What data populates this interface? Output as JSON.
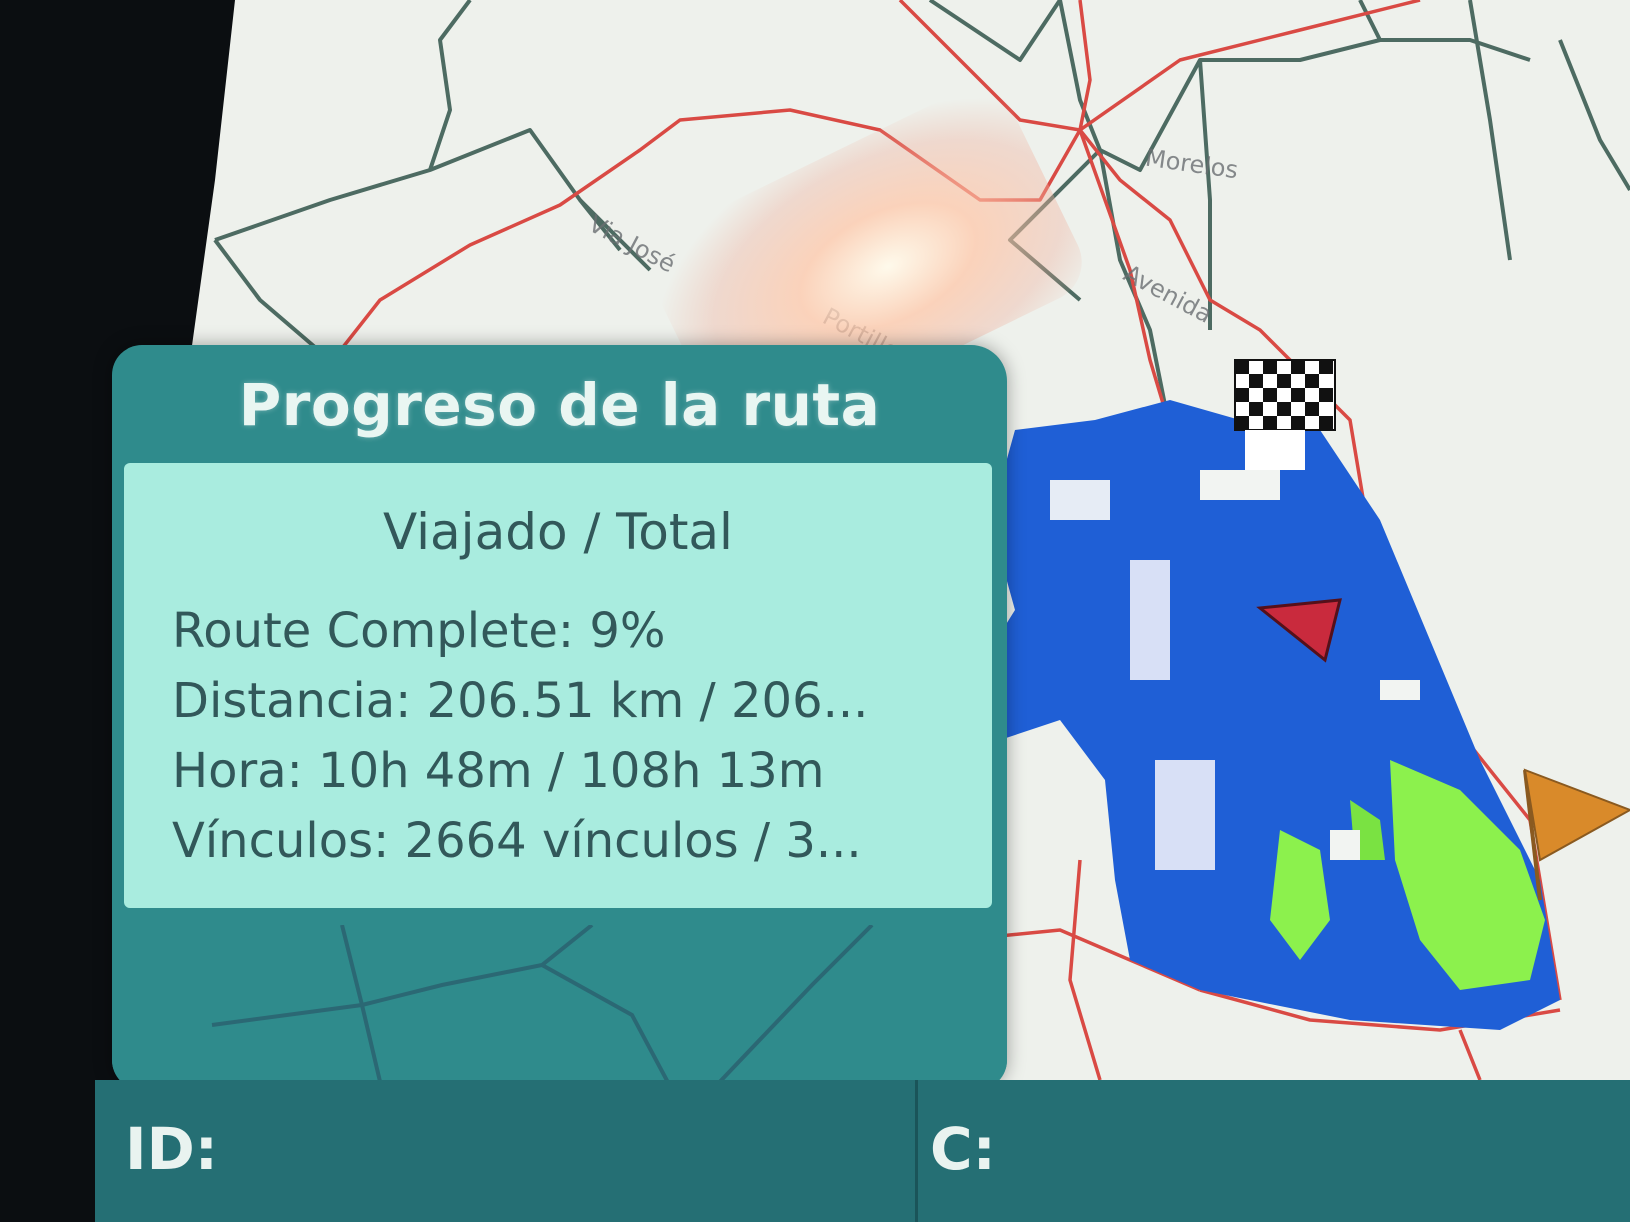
{
  "progress_panel": {
    "title": "Progreso de la ruta",
    "subtitle": "Viajado / Total",
    "route_complete": "Route Complete: 9%",
    "distancia": "Distancia: 206.51 km / 206...",
    "hora": "Hora: 10h 48m / 108h 13m",
    "vinculos": "Vínculos: 2664 vínculos / 3..."
  },
  "map": {
    "street_labels": [
      "Via José",
      "Portillo",
      "Avenida",
      "Morelos"
    ],
    "colors": {
      "background": "#eef1ec",
      "highway": "#d94a44",
      "road": "#4d6b62",
      "coverage": "#1f5fd6",
      "coverage_alt": "#8cf14d",
      "position_arrow": "#c92a3d",
      "destination_flag": "#d98a2a"
    },
    "icons": [
      "checkered-finish-flag-icon",
      "current-position-arrow-icon",
      "destination-flag-icon"
    ]
  },
  "status_bar": {
    "id_label": "ID:",
    "id_value": "",
    "c_label": "C:",
    "c_value": ""
  }
}
